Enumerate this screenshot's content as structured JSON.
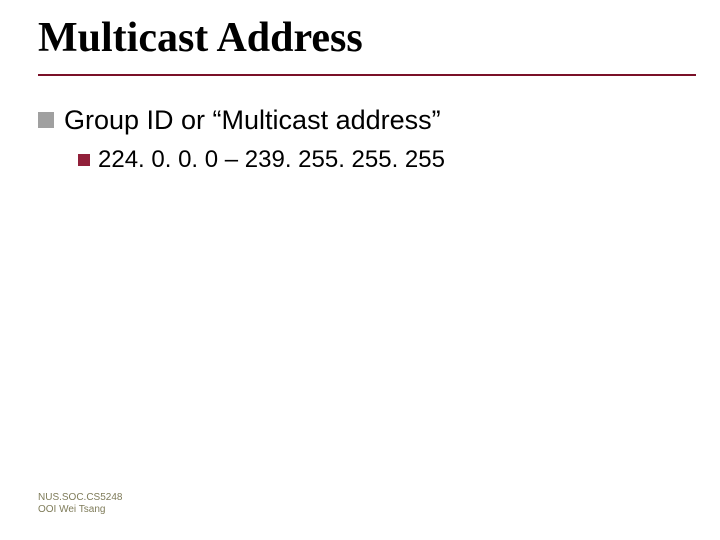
{
  "title": "Multicast Address",
  "bullets": {
    "level1": {
      "text": "Group ID or “Multicast address”"
    },
    "level2": {
      "text": "224. 0. 0. 0 – 239. 255. 255. 255"
    }
  },
  "footer": {
    "line1": "NUS.SOC.CS5248",
    "line2": "OOI Wei Tsang"
  },
  "colors": {
    "title_rule": "#7a1028",
    "bullet_level1": "#a0a0a0",
    "bullet_level2": "#91203a",
    "footer_text": "#7f7c5a"
  }
}
